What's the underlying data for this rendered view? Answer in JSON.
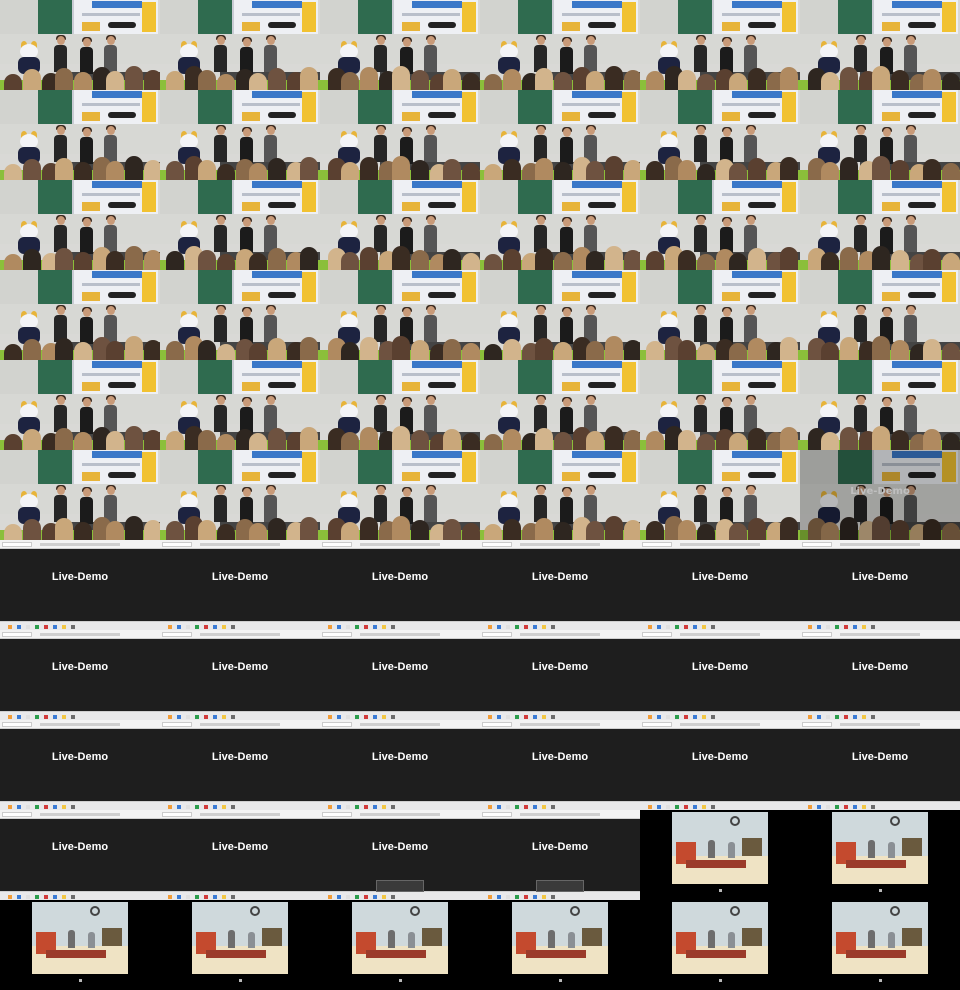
{
  "grid": {
    "columns": 6
  },
  "tiles": {
    "stage_count": 36,
    "slide_count": 22,
    "video_count": 8
  },
  "slide": {
    "title": "Live-Demo"
  },
  "colors": {
    "slide_background": "#1f1f1f",
    "stage_board": "#2f6b4f",
    "stage_desk": "#8bbf3a",
    "banner_blue": "#3b78c8",
    "banner_yellow": "#f1c232"
  }
}
